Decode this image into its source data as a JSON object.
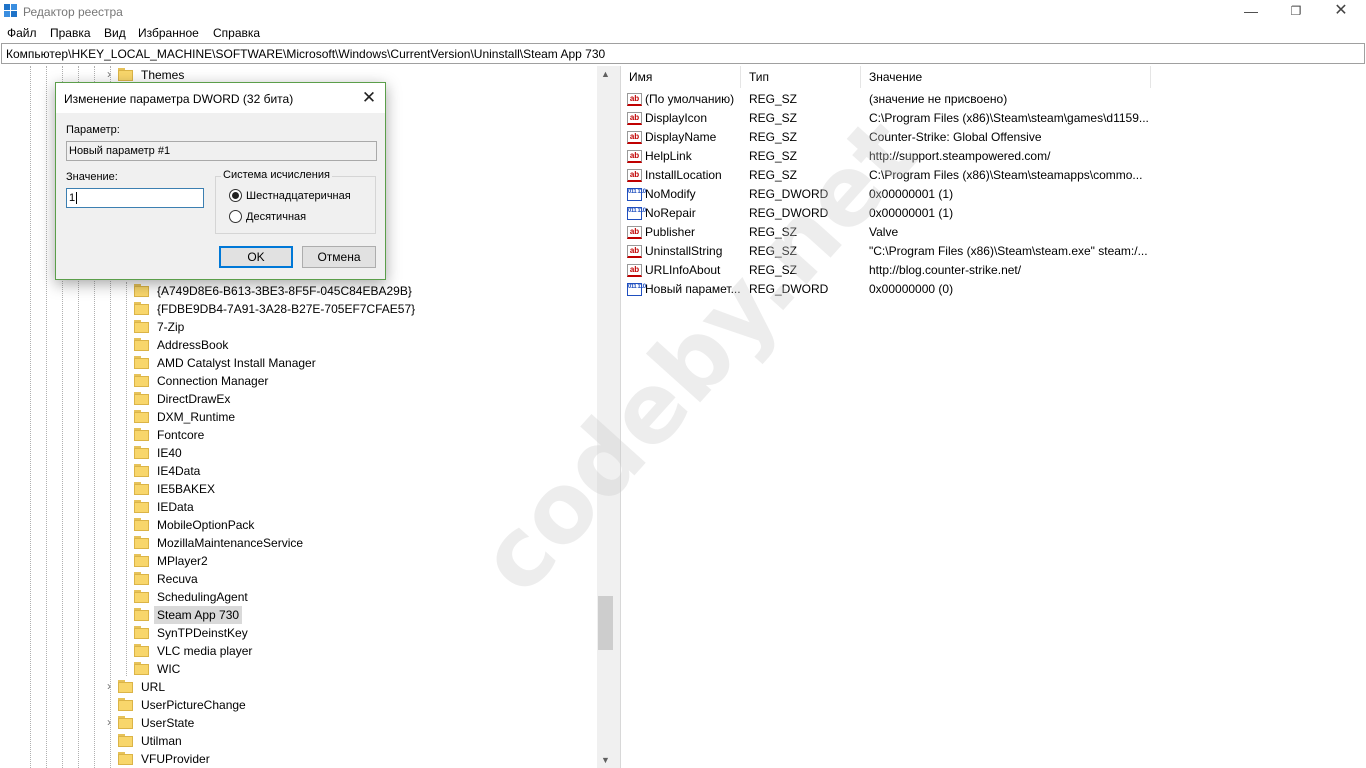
{
  "window": {
    "title": "Редактор реестра"
  },
  "menu": [
    "Файл",
    "Правка",
    "Вид",
    "Избранное",
    "Справка"
  ],
  "address": "Компьютер\\HKEY_LOCAL_MACHINE\\SOFTWARE\\Microsoft\\Windows\\CurrentVersion\\Uninstall\\Steam App 730",
  "tree": {
    "top_item": "Themes",
    "partial_visible_key": "}",
    "uninstall_children": [
      "{A749D8E6-B613-3BE3-8F5F-045C84EBA29B}",
      "{FDBE9DB4-7A91-3A28-B27E-705EF7CFAE57}",
      "7-Zip",
      "AddressBook",
      "AMD Catalyst Install Manager",
      "Connection Manager",
      "DirectDrawEx",
      "DXM_Runtime",
      "Fontcore",
      "IE40",
      "IE4Data",
      "IE5BAKEX",
      "IEData",
      "MobileOptionPack",
      "MozillaMaintenanceService",
      "MPlayer2",
      "Recuva",
      "SchedulingAgent",
      "Steam App 730",
      "SynTPDeinstKey",
      "VLC media player",
      "WIC"
    ],
    "selected": "Steam App 730",
    "after_items": [
      {
        "label": "URL",
        "expandable": true
      },
      {
        "label": "UserPictureChange",
        "expandable": false
      },
      {
        "label": "UserState",
        "expandable": true
      },
      {
        "label": "Utilman",
        "expandable": false
      },
      {
        "label": "VFUProvider",
        "expandable": false
      }
    ]
  },
  "list": {
    "columns": {
      "name": "Имя",
      "type": "Тип",
      "data": "Значение"
    },
    "rows": [
      {
        "icon": "string-value-icon",
        "name": "(По умолчанию)",
        "type": "REG_SZ",
        "data": "(значение не присвоено)"
      },
      {
        "icon": "string-value-icon",
        "name": "DisplayIcon",
        "type": "REG_SZ",
        "data": "C:\\Program Files (x86)\\Steam\\steam\\games\\d1159..."
      },
      {
        "icon": "string-value-icon",
        "name": "DisplayName",
        "type": "REG_SZ",
        "data": "Counter-Strike: Global Offensive"
      },
      {
        "icon": "string-value-icon",
        "name": "HelpLink",
        "type": "REG_SZ",
        "data": "http://support.steampowered.com/"
      },
      {
        "icon": "string-value-icon",
        "name": "InstallLocation",
        "type": "REG_SZ",
        "data": "C:\\Program Files (x86)\\Steam\\steamapps\\commo..."
      },
      {
        "icon": "dword-value-icon",
        "name": "NoModify",
        "type": "REG_DWORD",
        "data": "0x00000001 (1)"
      },
      {
        "icon": "dword-value-icon",
        "name": "NoRepair",
        "type": "REG_DWORD",
        "data": "0x00000001 (1)"
      },
      {
        "icon": "string-value-icon",
        "name": "Publisher",
        "type": "REG_SZ",
        "data": "Valve"
      },
      {
        "icon": "string-value-icon",
        "name": "UninstallString",
        "type": "REG_SZ",
        "data": "\"C:\\Program Files (x86)\\Steam\\steam.exe\" steam:/..."
      },
      {
        "icon": "string-value-icon",
        "name": "URLInfoAbout",
        "type": "REG_SZ",
        "data": "http://blog.counter-strike.net/"
      },
      {
        "icon": "dword-value-icon",
        "name": "Новый парамет...",
        "type": "REG_DWORD",
        "data": "0x00000000 (0)"
      }
    ]
  },
  "dialog": {
    "title": "Изменение параметра DWORD (32 бита)",
    "param_label": "Параметр:",
    "param_value": "Новый параметр #1",
    "value_label": "Значение:",
    "value": "1",
    "base_group_title": "Система исчисления",
    "base_options": [
      "Шестнадцатеричная",
      "Десятичная"
    ],
    "base_selected": "Шестнадцатеричная",
    "ok_label": "OK",
    "cancel_label": "Отмена"
  },
  "watermark": "codeby.net"
}
